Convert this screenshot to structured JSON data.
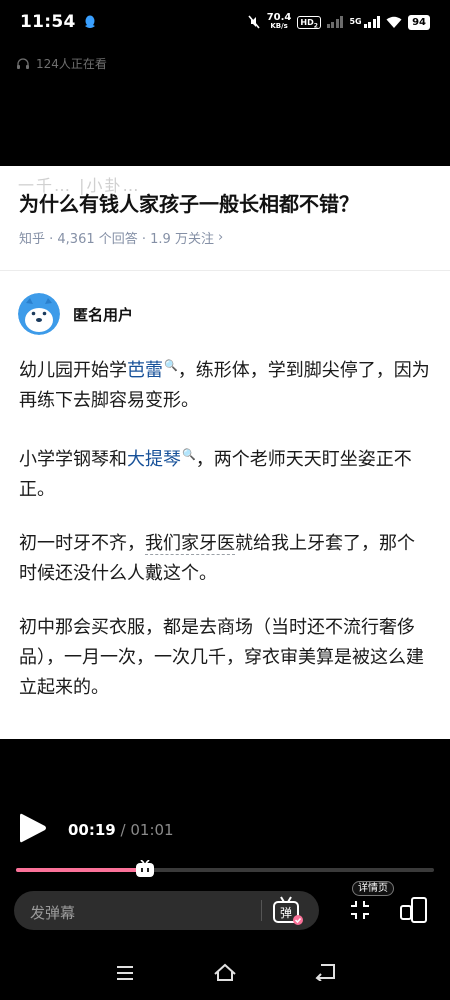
{
  "status_bar": {
    "time": "11:54",
    "net_speed_value": "70.4",
    "net_speed_unit": "KB/s",
    "hd_badge": "HD",
    "hd_sub": "2",
    "network_type": "5G",
    "battery": "94"
  },
  "viewers": {
    "text": "124人正在看",
    "icon": "headphone-icon"
  },
  "question": {
    "watermark": "一千… |小卦…",
    "title": "为什么有钱人家孩子一般长相都不错？",
    "meta": "知乎 · 4,361 个回答 · 1.9 万关注",
    "meta_chevron": "›"
  },
  "author": {
    "name": "匿名用户"
  },
  "answer": {
    "p1_a": "幼儿园开始学",
    "p1_kw": "芭蕾",
    "p1_b": "，练形体，学到脚尖停了，因为再练下去脚容易变形。",
    "p2_a": "小学学钢琴和",
    "p2_kw": "大提琴",
    "p2_b": "，两个老师天天盯坐姿正不正。",
    "p3_a": "初一时牙不齐，",
    "p3_dash": "我们家牙医",
    "p3_b": "就给我上牙套了，那个时候还没什么人戴这个。",
    "p4": "初中那会买衣服，都是去商场（当时还不流行奢侈品），一月一次，一次几千，穿衣审美算是被这么建立起来的。"
  },
  "player": {
    "current_time": "00:19",
    "separator": "/",
    "duration": "01:01",
    "progress": 0.31,
    "danmaku_placeholder": "发弹幕",
    "danmaku_toggle_label": "弹",
    "detail_label": "详情页"
  },
  "colors": {
    "accent_pink": "#fb7299",
    "link_blue": "#175199",
    "meta_gray": "#8590a6"
  }
}
